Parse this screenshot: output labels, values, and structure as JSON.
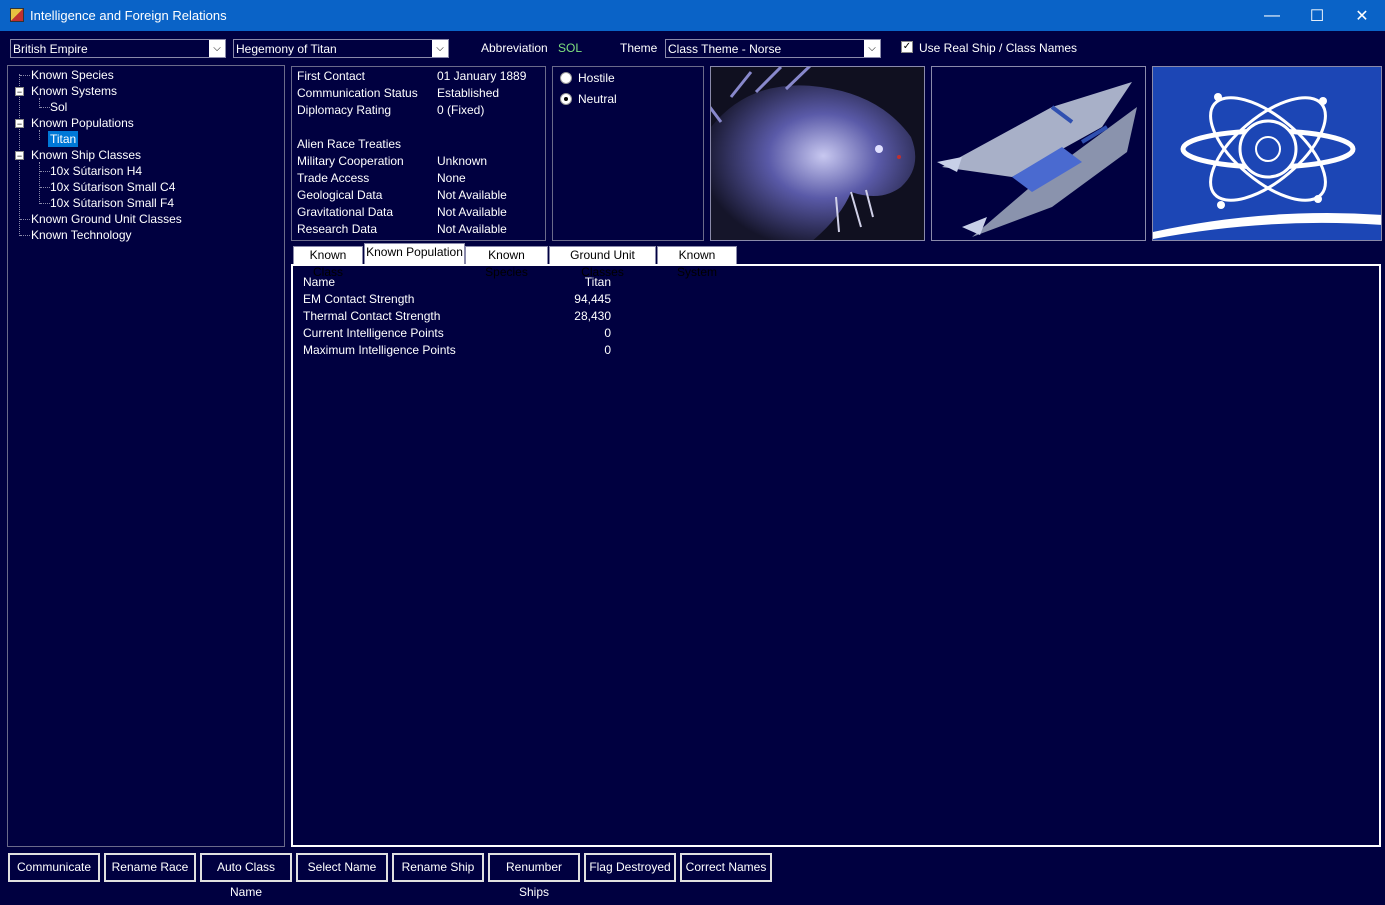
{
  "window": {
    "title": "Intelligence and Foreign Relations",
    "minimize": "—",
    "maximize": "☐",
    "close": "✕"
  },
  "top": {
    "race_combo": "British Empire",
    "target_combo": "Hegemony of Titan",
    "abbreviation_label": "Abbreviation",
    "abbreviation_value": "SOL",
    "theme_label": "Theme",
    "theme_combo": "Class Theme - Norse",
    "real_names_label": "Use Real Ship / Class Names",
    "real_names_checked": true
  },
  "tree": {
    "known_species": "Known Species",
    "known_systems": "Known Systems",
    "system_sol": "Sol",
    "known_populations": "Known Populations",
    "population_titan": "Titan",
    "known_ship_classes": "Known Ship Classes",
    "class_1": "10x Sútarison H4",
    "class_2": "10x Sútarison Small C4",
    "class_3": "10x Sútarison Small F4",
    "known_ground_unit_classes": "Known Ground Unit Classes",
    "known_technology": "Known Technology"
  },
  "relations": [
    {
      "label": "First Contact",
      "value": "01 January 1889"
    },
    {
      "label": "Communication Status",
      "value": "Established"
    },
    {
      "label": "Diplomacy Rating",
      "value": "0  (Fixed)"
    },
    {
      "label": "",
      "value": ""
    },
    {
      "label": "Alien Race Treaties",
      "value": ""
    },
    {
      "label": "Military Cooperation",
      "value": "Unknown"
    },
    {
      "label": "Trade Access",
      "value": "None"
    },
    {
      "label": "Geological Data",
      "value": "Not Available"
    },
    {
      "label": "Gravitational Data",
      "value": "Not Available"
    },
    {
      "label": "Research Data",
      "value": "Not Available"
    }
  ],
  "stance": {
    "hostile": "Hostile",
    "neutral": "Neutral",
    "selected": "Neutral"
  },
  "tabs": [
    "Known Class",
    "Known Population",
    "Known Species",
    "Ground Unit Classes",
    "Known System"
  ],
  "active_tab": "Known Population",
  "population_details": [
    {
      "label": "Name",
      "value": "Titan"
    },
    {
      "label": "EM Contact Strength",
      "value": "94,445"
    },
    {
      "label": "Thermal Contact Strength",
      "value": "28,430"
    },
    {
      "label": "Current Intelligence Points",
      "value": "0"
    },
    {
      "label": "Maximum Intelligence Points",
      "value": "0"
    }
  ],
  "buttons": [
    "Communicate",
    "Rename Race",
    "Auto Class Name",
    "Select Name",
    "Rename Ship",
    "Renumber Ships",
    "Flag Destroyed",
    "Correct Names"
  ],
  "colors": {
    "background": "#000040",
    "titlebar": "#0a63c7",
    "selection": "#0078d7",
    "abbreviation": "#7fe07f"
  },
  "icons": {
    "app": "app-icon",
    "dropdown": "chevron-down-icon",
    "checkbox": "checkbox-checked-icon"
  }
}
